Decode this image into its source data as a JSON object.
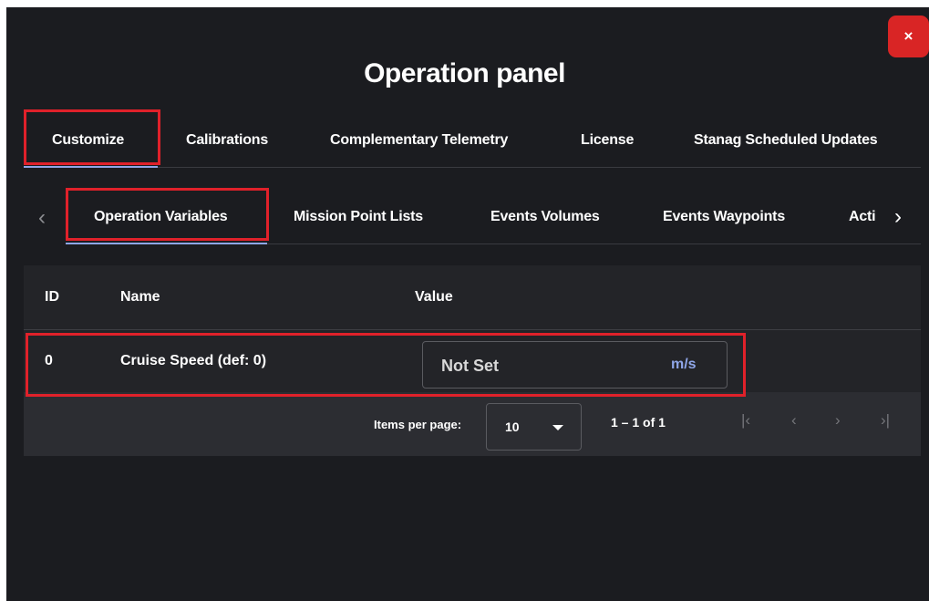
{
  "dialog": {
    "title": "Operation panel",
    "close_label": "×"
  },
  "main_tabs": [
    {
      "label": "Customize",
      "active": true
    },
    {
      "label": "Calibrations"
    },
    {
      "label": "Complementary Telemetry"
    },
    {
      "label": "License"
    },
    {
      "label": "Stanag Scheduled Updates"
    }
  ],
  "sub_tabs": [
    {
      "label": "Operation Variables",
      "active": true
    },
    {
      "label": "Mission Point Lists"
    },
    {
      "label": "Events Volumes"
    },
    {
      "label": "Events Waypoints"
    },
    {
      "label": "Acti"
    }
  ],
  "sub_nav": {
    "prev_icon": "‹",
    "next_icon": "›"
  },
  "table": {
    "columns": {
      "id": "ID",
      "name": "Name",
      "value": "Value"
    },
    "rows": [
      {
        "id": "0",
        "name": "Cruise Speed (def: 0)",
        "value": "Not Set",
        "unit": "m/s"
      }
    ]
  },
  "paginator": {
    "items_per_page_label": "Items per page:",
    "page_size": "10",
    "range_label": "1 – 1 of 1",
    "first_icon": "|‹",
    "prev_icon": "‹",
    "next_icon": "›",
    "last_icon": "›|"
  },
  "colors": {
    "background": "#1b1c20",
    "accent": "#8fa6e8",
    "highlight": "#e0212a",
    "close_button": "#d92525"
  }
}
